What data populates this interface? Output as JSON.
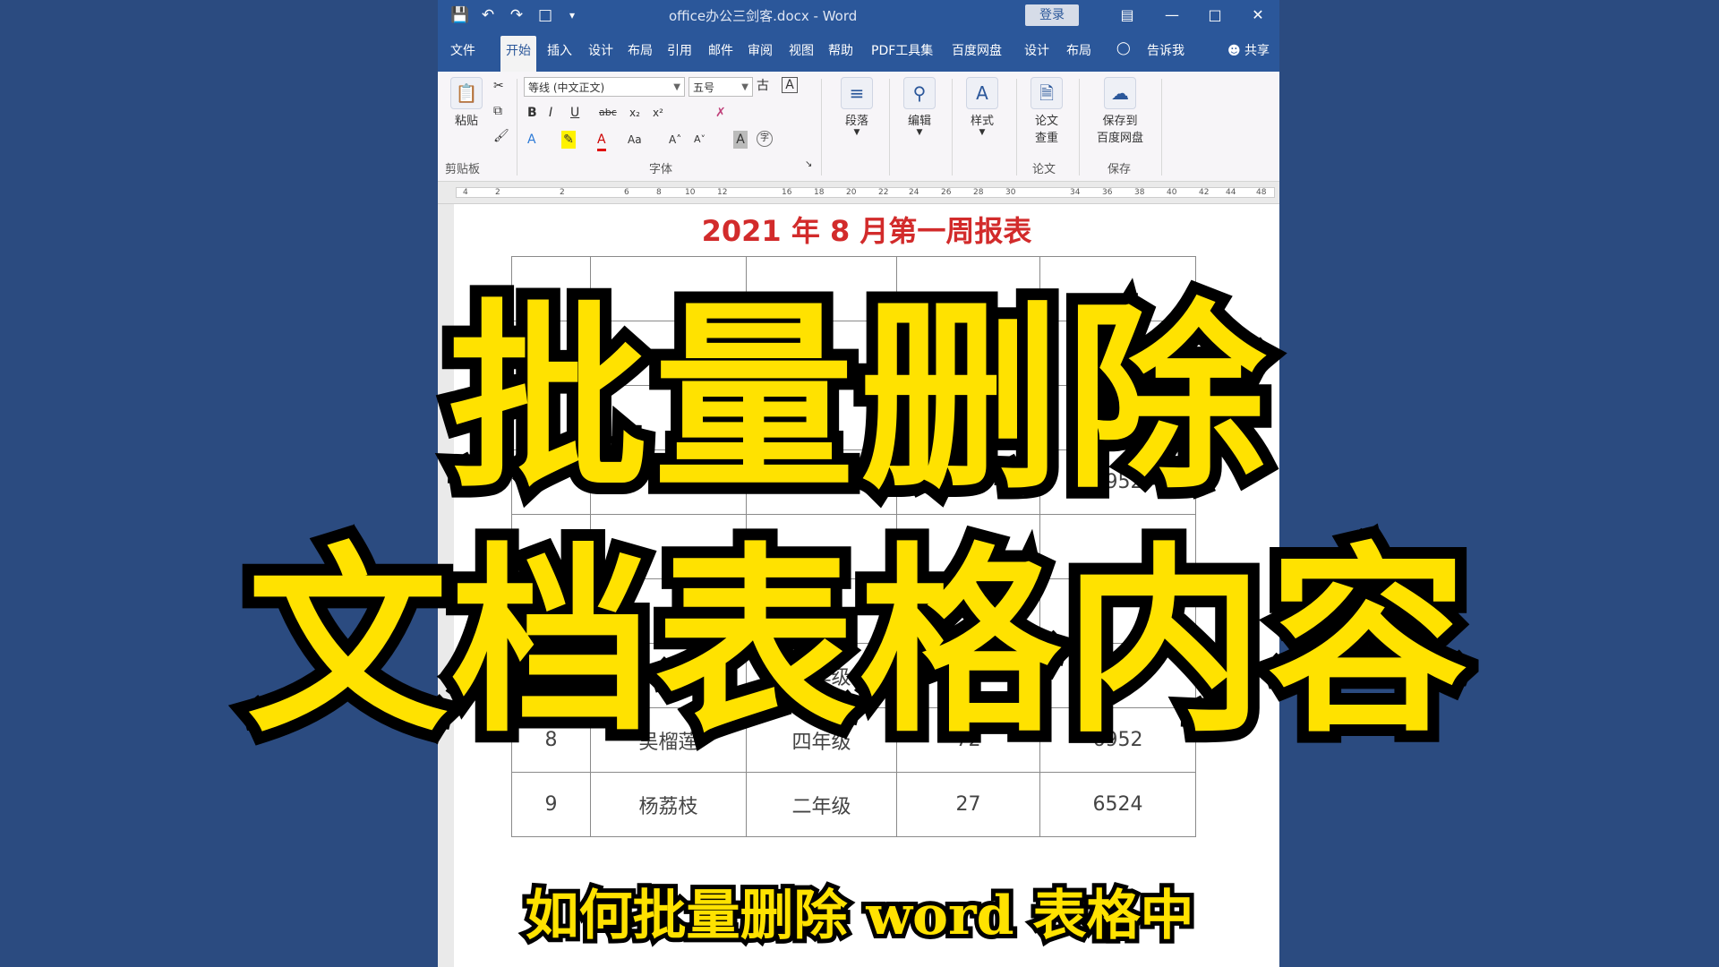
{
  "window": {
    "doc_title": "office办公三剑客.docx  -  Word",
    "login_label": "登录",
    "quick_access": [
      "save-icon",
      "undo-icon",
      "redo-icon",
      "touch-icon",
      "customize-icon"
    ]
  },
  "tabs": [
    {
      "label": "文件"
    },
    {
      "label": "开始",
      "active": true
    },
    {
      "label": "插入"
    },
    {
      "label": "设计"
    },
    {
      "label": "布局"
    },
    {
      "label": "引用"
    },
    {
      "label": "邮件"
    },
    {
      "label": "审阅"
    },
    {
      "label": "视图"
    },
    {
      "label": "帮助"
    },
    {
      "label": "PDF工具集"
    },
    {
      "label": "百度网盘"
    },
    {
      "label": "设计"
    },
    {
      "label": "布局"
    }
  ],
  "tell_me": "告诉我",
  "share": "共享",
  "ribbon": {
    "clipboard": {
      "paste": "粘贴",
      "label": "剪贴板"
    },
    "font": {
      "name": "等线 (中文正文)",
      "size": "五号",
      "label": "字体",
      "bold": "B",
      "italic": "I",
      "underline": "U",
      "strike": "abc",
      "sub": "x₂",
      "sup": "x²",
      "case": "Aa",
      "grow": "A˄",
      "shrink": "A˅"
    },
    "paragraph": "段落",
    "editing": "编辑",
    "styles": "样式",
    "thesis": {
      "check_line1": "论文",
      "check_line2": "查重",
      "label": "论文"
    },
    "save": {
      "line1": "保存到",
      "line2": "百度网盘",
      "label": "保存"
    }
  },
  "ruler_ticks": [
    "4",
    "2",
    "2",
    "6",
    "8",
    "10",
    "12",
    "16",
    "18",
    "20",
    "22",
    "24",
    "26",
    "28",
    "30",
    "34",
    "36",
    "38",
    "40",
    "42",
    "44",
    "48"
  ],
  "document": {
    "heading": "2021 年 8 月第一周报表",
    "rows": [
      [
        "",
        "",
        "",
        "",
        ""
      ],
      [
        "",
        "",
        "",
        "",
        ""
      ],
      [
        "",
        "",
        "",
        "",
        ""
      ],
      [
        "",
        "",
        "",
        "",
        "6952"
      ],
      [
        "",
        "",
        "",
        "",
        ""
      ],
      [
        "",
        "",
        "",
        "",
        ""
      ],
      [
        "7",
        "刘豆浆",
        "二年级",
        "117",
        "4852"
      ],
      [
        "8",
        "吴榴莲",
        "四年级",
        "72",
        "6952"
      ],
      [
        "9",
        "杨荔枝",
        "二年级",
        "27",
        "6524"
      ]
    ]
  },
  "overlay": {
    "line1": "批量删除",
    "line2": "文档表格内容",
    "subtitle": "如何批量删除 word 表格中"
  }
}
